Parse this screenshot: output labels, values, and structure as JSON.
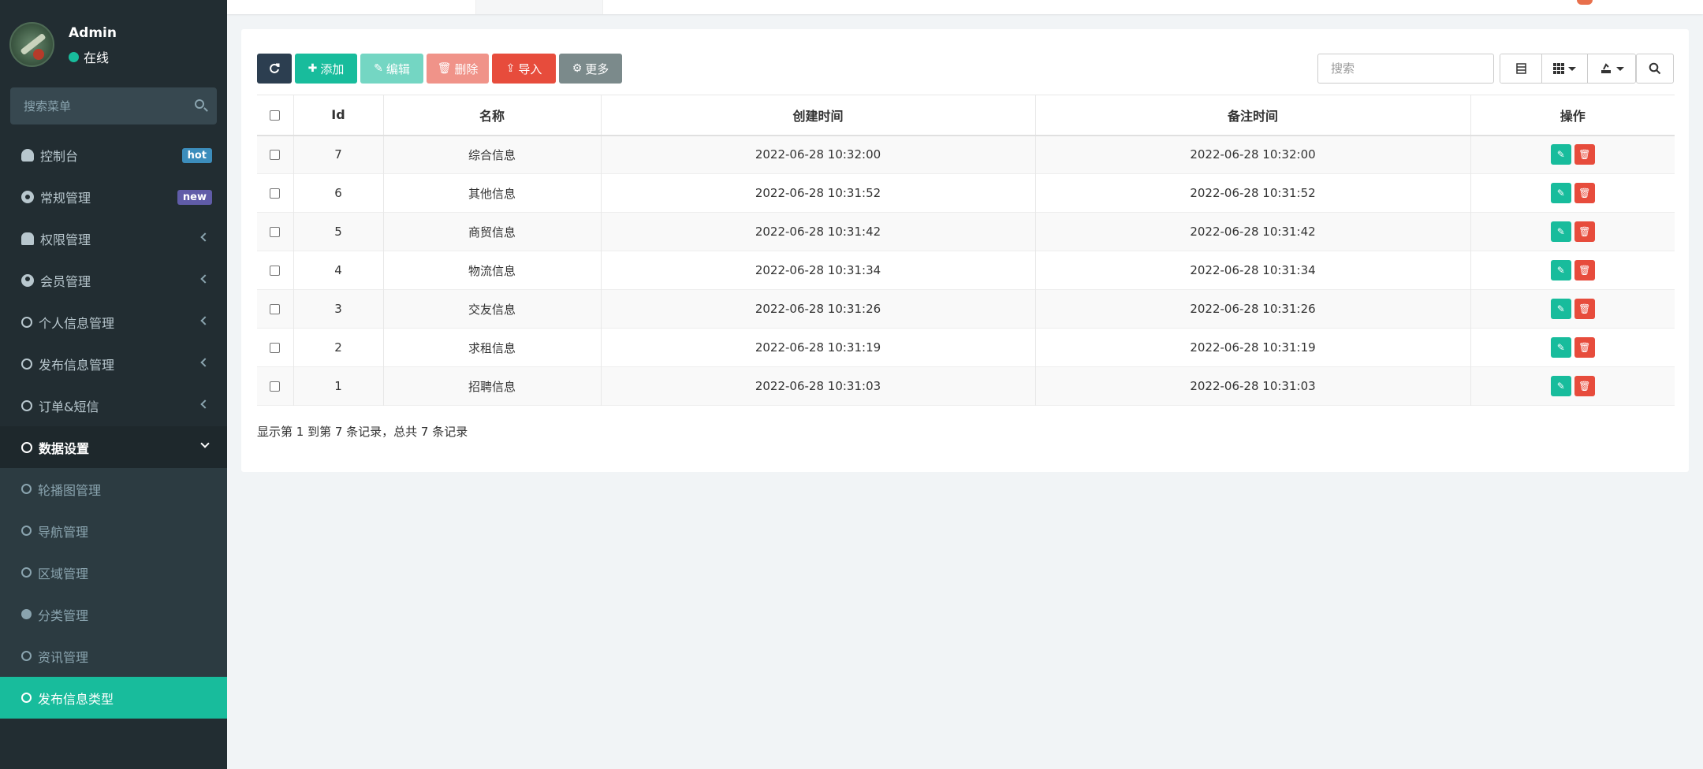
{
  "user": {
    "name": "Admin",
    "status": "在线"
  },
  "sidebar": {
    "search_placeholder": "搜索菜单",
    "items": [
      {
        "label": "控制台",
        "badge": "hot"
      },
      {
        "label": "常规管理",
        "badge": "new"
      },
      {
        "label": "权限管理"
      },
      {
        "label": "会员管理"
      },
      {
        "label": "个人信息管理"
      },
      {
        "label": "发布信息管理"
      },
      {
        "label": "订单&短信"
      },
      {
        "label": "数据设置"
      }
    ],
    "sub_items": [
      {
        "label": "轮播图管理"
      },
      {
        "label": "导航管理"
      },
      {
        "label": "区域管理"
      },
      {
        "label": "分类管理"
      },
      {
        "label": "资讯管理"
      },
      {
        "label": "发布信息类型"
      }
    ]
  },
  "toolbar": {
    "add": "添加",
    "edit": "编辑",
    "delete": "删除",
    "import": "导入",
    "more": "更多",
    "search_placeholder": "搜索"
  },
  "table": {
    "columns": [
      "Id",
      "名称",
      "创建时间",
      "备注时间",
      "操作"
    ],
    "rows": [
      {
        "id": "7",
        "name": "综合信息",
        "created": "2022-06-28 10:32:00",
        "remark": "2022-06-28 10:32:00"
      },
      {
        "id": "6",
        "name": "其他信息",
        "created": "2022-06-28 10:31:52",
        "remark": "2022-06-28 10:31:52"
      },
      {
        "id": "5",
        "name": "商贸信息",
        "created": "2022-06-28 10:31:42",
        "remark": "2022-06-28 10:31:42"
      },
      {
        "id": "4",
        "name": "物流信息",
        "created": "2022-06-28 10:31:34",
        "remark": "2022-06-28 10:31:34"
      },
      {
        "id": "3",
        "name": "交友信息",
        "created": "2022-06-28 10:31:26",
        "remark": "2022-06-28 10:31:26"
      },
      {
        "id": "2",
        "name": "求租信息",
        "created": "2022-06-28 10:31:19",
        "remark": "2022-06-28 10:31:19"
      },
      {
        "id": "1",
        "name": "招聘信息",
        "created": "2022-06-28 10:31:03",
        "remark": "2022-06-28 10:31:03"
      }
    ]
  },
  "pagination": {
    "summary": "显示第 1 到第 7 条记录，总共 7 条记录"
  },
  "colors": {
    "accent": "#18bc9c",
    "danger": "#e74c3c",
    "sidebar_bg": "#222d32"
  }
}
